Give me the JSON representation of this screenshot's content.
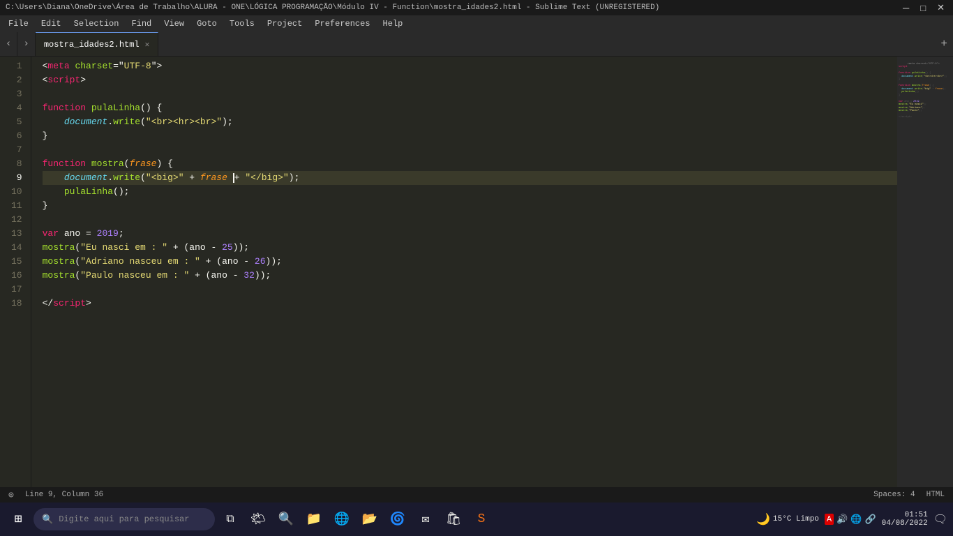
{
  "titlebar": {
    "title": "C:\\Users\\Diana\\OneDrive\\Área de Trabalho\\ALURA - ONE\\LÓGICA PROGRAMAÇÃO\\Módulo IV - Function\\mostra_idades2.html - Sublime Text (UNREGISTERED)",
    "controls": [
      "─",
      "□",
      "✕"
    ]
  },
  "menubar": {
    "items": [
      "File",
      "Edit",
      "Selection",
      "Find",
      "View",
      "Goto",
      "Tools",
      "Project",
      "Preferences",
      "Help"
    ]
  },
  "tabs": [
    {
      "label": "mostra_idades2.html",
      "active": true
    }
  ],
  "editor": {
    "lines": [
      {
        "num": 1,
        "content": "meta",
        "type": "meta"
      },
      {
        "num": 2,
        "content": "script_open",
        "type": "script_open"
      },
      {
        "num": 3,
        "content": "",
        "type": "empty"
      },
      {
        "num": 4,
        "content": "fn_pula_open",
        "type": "fn_pula_open"
      },
      {
        "num": 5,
        "content": "doc_write_br",
        "type": "doc_write_br"
      },
      {
        "num": 6,
        "content": "close_brace",
        "type": "close_brace"
      },
      {
        "num": 7,
        "content": "",
        "type": "empty"
      },
      {
        "num": 8,
        "content": "fn_mostra_open",
        "type": "fn_mostra_open"
      },
      {
        "num": 9,
        "content": "doc_write_big",
        "type": "doc_write_big",
        "active": true
      },
      {
        "num": 10,
        "content": "pula_linha_call",
        "type": "pula_linha_call"
      },
      {
        "num": 11,
        "content": "close_brace",
        "type": "close_brace"
      },
      {
        "num": 12,
        "content": "",
        "type": "empty"
      },
      {
        "num": 13,
        "content": "var_ano",
        "type": "var_ano"
      },
      {
        "num": 14,
        "content": "mostra_eu",
        "type": "mostra_eu"
      },
      {
        "num": 15,
        "content": "mostra_adriano",
        "type": "mostra_adriano"
      },
      {
        "num": 16,
        "content": "mostra_paulo",
        "type": "mostra_paulo"
      },
      {
        "num": 17,
        "content": "",
        "type": "empty"
      },
      {
        "num": 18,
        "content": "script_close",
        "type": "script_close"
      }
    ]
  },
  "statusbar": {
    "position": "Line 9, Column 36",
    "spaces": "Spaces: 4",
    "encoding": "HTML"
  },
  "taskbar": {
    "search_placeholder": "Digite aqui para pesquisar",
    "weather": "15°C  Limpo",
    "time": "01:51",
    "date": "04/08/2022",
    "start_icon": "⊞"
  }
}
